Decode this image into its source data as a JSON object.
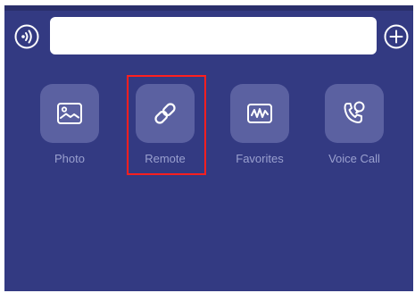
{
  "search": {
    "value": "",
    "placeholder": ""
  },
  "header": {
    "voice_icon": "voice-wave-icon",
    "add_icon": "plus-circle-icon"
  },
  "actions": [
    {
      "label": "Photo",
      "icon": "photo-icon"
    },
    {
      "label": "Remote",
      "icon": "link-icon"
    },
    {
      "label": "Favorites",
      "icon": "waveform-icon"
    },
    {
      "label": "Voice Call",
      "icon": "voice-call-icon"
    }
  ],
  "colors": {
    "background": "#333a82",
    "tile": "#5b61a1",
    "label": "#9aa0cf",
    "highlight": "#ff1f1f"
  }
}
